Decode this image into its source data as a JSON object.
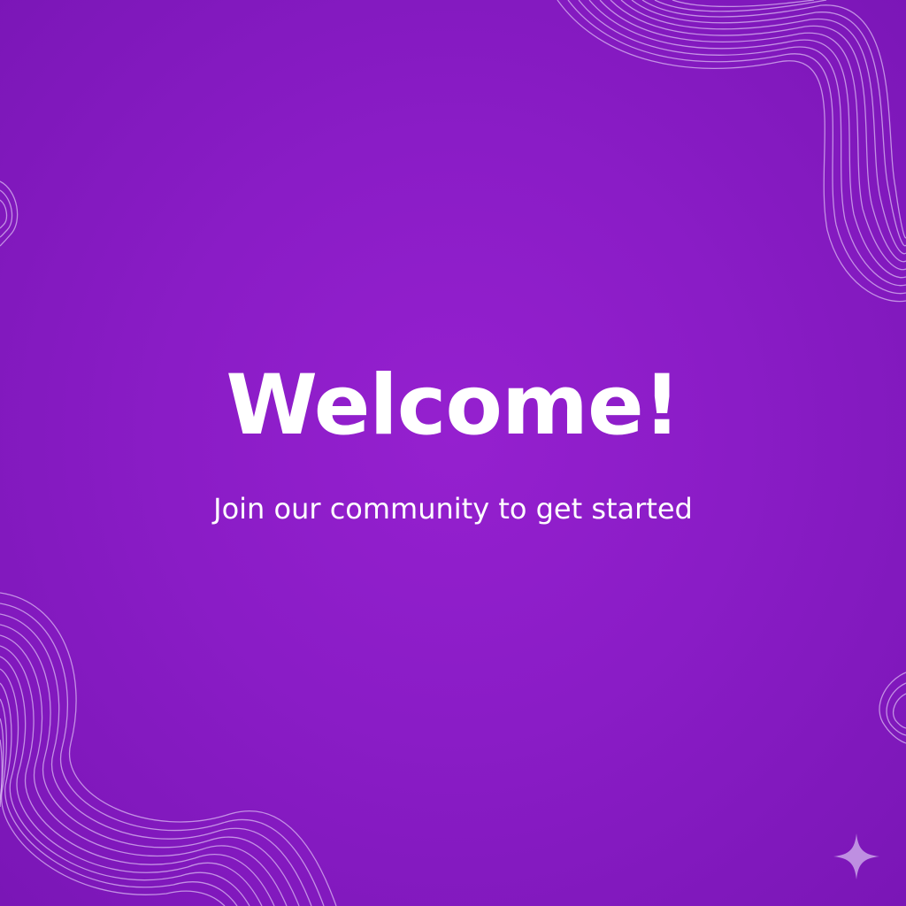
{
  "colors": {
    "background": "#8a1cc6",
    "text": "#ffffff",
    "line_art": "#d9b8f2",
    "sparkle": "#c9a4e8"
  },
  "welcome": {
    "title": "Welcome!",
    "subtitle": "Join our community to get started"
  },
  "icons": {
    "sparkle": "sparkle-icon"
  }
}
